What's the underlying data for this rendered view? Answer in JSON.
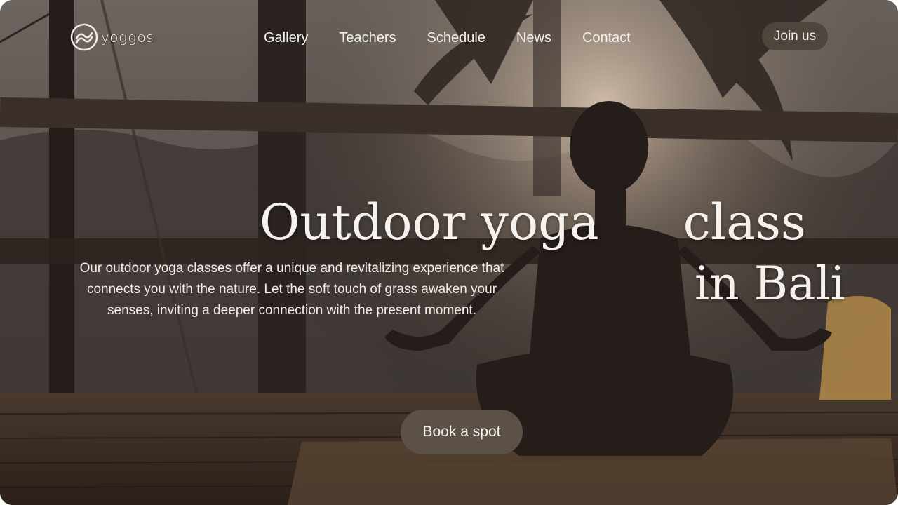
{
  "brand": {
    "name": "yoggos",
    "logo_icon": "waves-logo-icon"
  },
  "nav": {
    "items": [
      {
        "label": "Gallery"
      },
      {
        "label": "Teachers"
      },
      {
        "label": "Schedule"
      },
      {
        "label": "News"
      },
      {
        "label": "Contact"
      }
    ],
    "cta_label": "Join us"
  },
  "hero": {
    "title_part1": "Outdoor yoga",
    "title_part2": "class",
    "title_line2": "in Bali",
    "description": "Our outdoor yoga classes offer a unique and revitalizing experience that connects you with the nature. Let the soft touch of grass awaken your senses, inviting a deeper connection with the present moment.",
    "cta_label": "Book a spot"
  },
  "colors": {
    "button_bg": "#4e463c",
    "book_button_bg": "#5b5147",
    "text_light": "#f4f0ec"
  }
}
